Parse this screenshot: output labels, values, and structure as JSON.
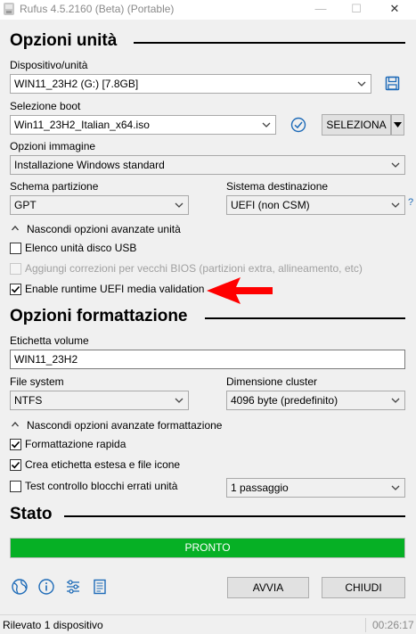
{
  "window": {
    "title": "Rufus 4.5.2160 (Beta) (Portable)",
    "minimize": "—",
    "maximize": "☐",
    "close": "✕"
  },
  "drive_options": {
    "section_title": "Opzioni unità",
    "device_label": "Dispositivo/unità",
    "device_value": "WIN11_23H2 (G:) [7.8GB]",
    "boot_label": "Selezione boot",
    "boot_value": "Win11_23H2_Italian_x64.iso",
    "select_button": "SELEZIONA",
    "image_label": "Opzioni immagine",
    "image_value": "Installazione Windows standard",
    "partition_label": "Schema partizione",
    "partition_value": "GPT",
    "target_label": "Sistema destinazione",
    "target_value": "UEFI (non CSM)",
    "help_mark": "?",
    "advanced_toggle": "Nascondi opzioni avanzate unità",
    "list_usb": "Elenco unità disco USB",
    "bios_fixes": "Aggiungi correzioni per vecchi BIOS (partizioni extra, allineamento, etc)",
    "uefi_validation": "Enable runtime UEFI media validation"
  },
  "format_options": {
    "section_title": "Opzioni formattazione",
    "volume_label": "Etichetta volume",
    "volume_value": "WIN11_23H2",
    "fs_label": "File system",
    "fs_value": "NTFS",
    "cluster_label": "Dimensione cluster",
    "cluster_value": "4096 byte (predefinito)",
    "advanced_toggle": "Nascondi opzioni avanzate formattazione",
    "quick_format": "Formattazione rapida",
    "extended_label": "Crea etichetta estesa e file icone",
    "bad_blocks": "Test controllo blocchi errati unità",
    "passes_value": "1 passaggio"
  },
  "status": {
    "section_title": "Stato",
    "progress_text": "PRONTO",
    "progress_fraction": 1.0
  },
  "actions": {
    "start": "AVVIA",
    "close": "CHIUDI"
  },
  "statusbar": {
    "message": "Rilevato 1 dispositivo",
    "elapsed": "00:26:17"
  },
  "colors": {
    "accent": "#1e6bb8",
    "progress": "#06b025",
    "arrow": "#ff0000"
  }
}
